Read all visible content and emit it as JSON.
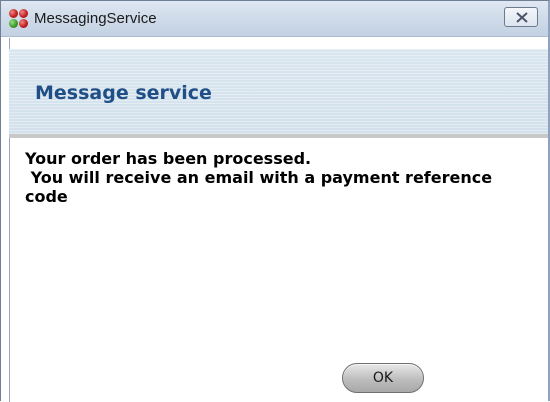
{
  "window": {
    "title": "MessagingService",
    "close_icon": "close-icon",
    "app_icon": "app-logo-icon"
  },
  "header": {
    "title": "Message service"
  },
  "message": {
    "text": "Your order has been processed.\n You will receive an email with a payment reference code"
  },
  "actions": {
    "ok_label": "OK"
  },
  "colors": {
    "header_text": "#1f4f86",
    "header_bg": "#d3e1ec",
    "titlebar_bg": "#cfdbe9"
  }
}
